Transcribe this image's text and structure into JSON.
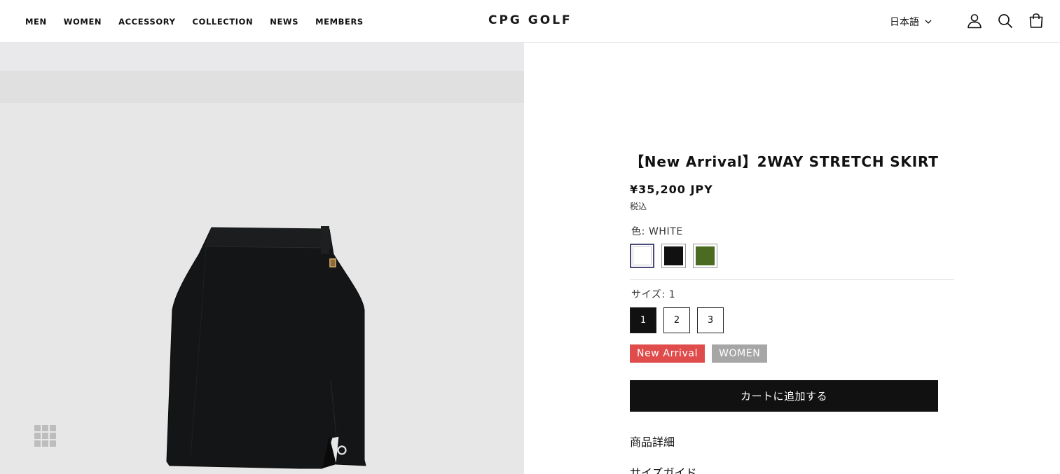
{
  "nav": {
    "items": [
      "MEN",
      "WOMEN",
      "ACCESSORY",
      "COLLECTION",
      "NEWS",
      "MEMBERS"
    ]
  },
  "brand": {
    "logo": "CPG GOLF"
  },
  "header": {
    "language": "日本語",
    "icons": [
      "account-icon",
      "search-icon",
      "cart-icon"
    ]
  },
  "product": {
    "title": "【New Arrival】2WAY STRETCH SKIRT",
    "price": "¥35,200 JPY",
    "tax_note": "税込",
    "color_label": "色: WHITE",
    "colors": [
      {
        "name": "WHITE",
        "hex": "#ffffff",
        "selected": true
      },
      {
        "name": "BLACK",
        "hex": "#111111",
        "selected": false
      },
      {
        "name": "GREEN",
        "hex": "#4a6b21",
        "selected": false
      }
    ],
    "size_label": "サイズ: 1",
    "sizes": [
      "1",
      "2",
      "3"
    ],
    "selected_size": "1",
    "tags": [
      {
        "label": "New Arrival",
        "color": "#e04c4c"
      },
      {
        "label": "WOMEN",
        "color": "#a6a6a6"
      }
    ],
    "add_to_cart": "カートに追加する",
    "details_link": "商品詳細",
    "size_guide_link": "サイズガイド"
  }
}
